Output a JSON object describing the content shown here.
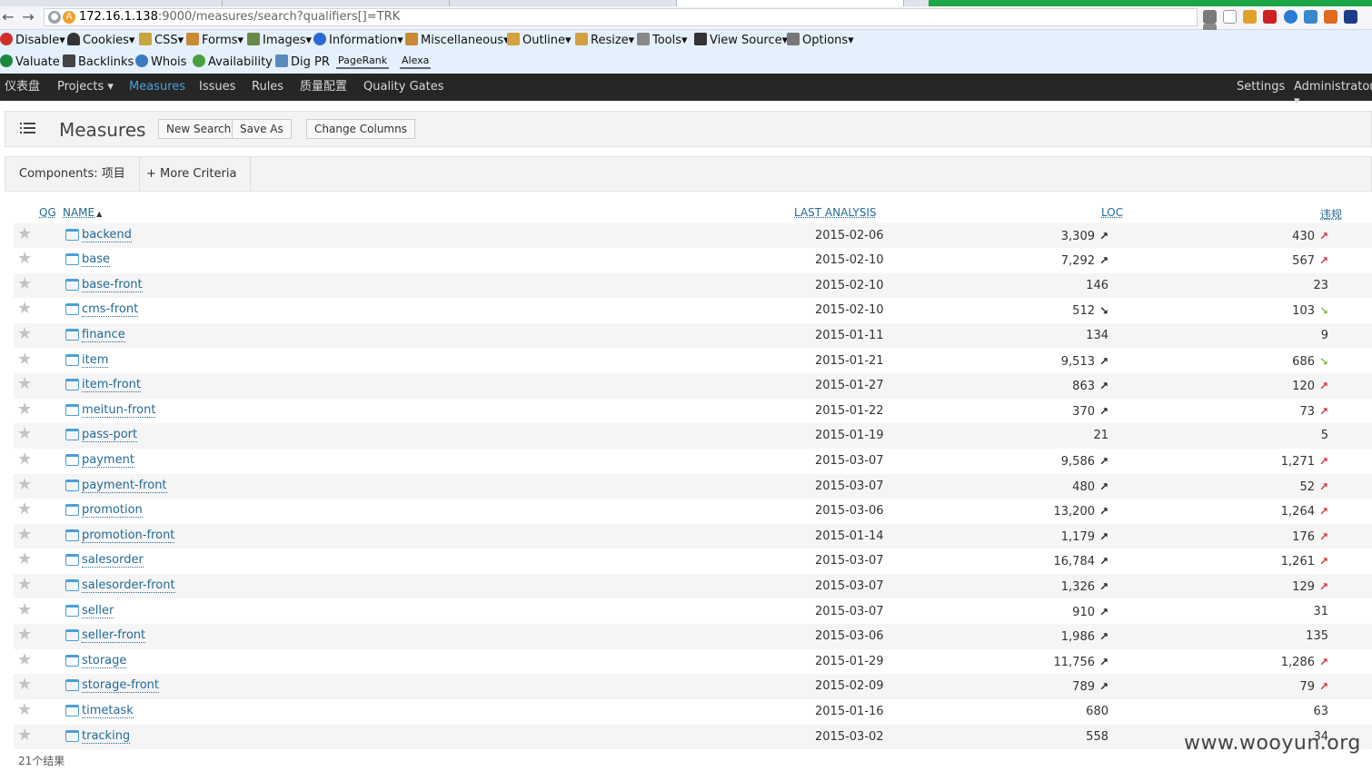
{
  "browser": {
    "url_host": "172.16.1.138",
    "url_rest": ":9000/measures/search?qualifiers[]=TRK"
  },
  "toolbar1": [
    "Disable",
    "Cookies",
    "CSS",
    "Forms",
    "Images",
    "Information",
    "Miscellaneous",
    "Outline",
    "Resize",
    "Tools",
    "View Source",
    "Options"
  ],
  "toolbar2": [
    "Valuate",
    "Backlinks",
    "Whois",
    "Availability",
    "Dig PR"
  ],
  "toolbar2_buttons": [
    "PageRank",
    "Alexa"
  ],
  "nav": {
    "dashboard": "仪表盘",
    "projects": "Projects",
    "measures": "Measures",
    "issues": "Issues",
    "rules": "Rules",
    "quality_profiles": "质量配置",
    "quality_gates": "Quality Gates",
    "settings": "Settings",
    "user": "Administrator"
  },
  "header": {
    "title": "Measures",
    "new_search": "New Search",
    "save_as": "Save As",
    "change_columns": "Change Columns"
  },
  "criteria": {
    "components": "Components: 项目",
    "more": "+ More Criteria"
  },
  "columns": {
    "qg": "QG",
    "name": "NAME",
    "last_analysis": "LAST ANALYSIS",
    "loc": "LOC",
    "violations": "违规"
  },
  "rows": [
    {
      "name": "backend",
      "date": "2015-02-06",
      "loc": "3,309",
      "loc_trend": "up-dark",
      "viol": "430",
      "viol_trend": "up-red"
    },
    {
      "name": "base",
      "date": "2015-02-10",
      "loc": "7,292",
      "loc_trend": "up-dark",
      "viol": "567",
      "viol_trend": "up-red"
    },
    {
      "name": "base-front",
      "date": "2015-02-10",
      "loc": "146",
      "loc_trend": "none",
      "viol": "23",
      "viol_trend": "none"
    },
    {
      "name": "cms-front",
      "date": "2015-02-10",
      "loc": "512",
      "loc_trend": "down-dark",
      "viol": "103",
      "viol_trend": "down-green"
    },
    {
      "name": "finance",
      "date": "2015-01-11",
      "loc": "134",
      "loc_trend": "none",
      "viol": "9",
      "viol_trend": "none"
    },
    {
      "name": "item",
      "date": "2015-01-21",
      "loc": "9,513",
      "loc_trend": "up-dark",
      "viol": "686",
      "viol_trend": "down-green"
    },
    {
      "name": "item-front",
      "date": "2015-01-27",
      "loc": "863",
      "loc_trend": "up-dark",
      "viol": "120",
      "viol_trend": "up-red"
    },
    {
      "name": "meitun-front",
      "date": "2015-01-22",
      "loc": "370",
      "loc_trend": "up-dark",
      "viol": "73",
      "viol_trend": "up-red"
    },
    {
      "name": "pass-port",
      "date": "2015-01-19",
      "loc": "21",
      "loc_trend": "none",
      "viol": "5",
      "viol_trend": "none"
    },
    {
      "name": "payment",
      "date": "2015-03-07",
      "loc": "9,586",
      "loc_trend": "up-dark",
      "viol": "1,271",
      "viol_trend": "up-red"
    },
    {
      "name": "payment-front",
      "date": "2015-03-07",
      "loc": "480",
      "loc_trend": "up-dark",
      "viol": "52",
      "viol_trend": "up-red"
    },
    {
      "name": "promotion",
      "date": "2015-03-06",
      "loc": "13,200",
      "loc_trend": "up-dark",
      "viol": "1,264",
      "viol_trend": "up-red"
    },
    {
      "name": "promotion-front",
      "date": "2015-01-14",
      "loc": "1,179",
      "loc_trend": "up-dark",
      "viol": "176",
      "viol_trend": "up-red"
    },
    {
      "name": "salesorder",
      "date": "2015-03-07",
      "loc": "16,784",
      "loc_trend": "up-dark",
      "viol": "1,261",
      "viol_trend": "up-red"
    },
    {
      "name": "salesorder-front",
      "date": "2015-03-07",
      "loc": "1,326",
      "loc_trend": "up-dark",
      "viol": "129",
      "viol_trend": "up-red"
    },
    {
      "name": "seller",
      "date": "2015-03-07",
      "loc": "910",
      "loc_trend": "up-dark",
      "viol": "31",
      "viol_trend": "none"
    },
    {
      "name": "seller-front",
      "date": "2015-03-06",
      "loc": "1,986",
      "loc_trend": "up-dark",
      "viol": "135",
      "viol_trend": "none"
    },
    {
      "name": "storage",
      "date": "2015-01-29",
      "loc": "11,756",
      "loc_trend": "up-dark",
      "viol": "1,286",
      "viol_trend": "up-red"
    },
    {
      "name": "storage-front",
      "date": "2015-02-09",
      "loc": "789",
      "loc_trend": "up-dark",
      "viol": "79",
      "viol_trend": "up-red"
    },
    {
      "name": "timetask",
      "date": "2015-01-16",
      "loc": "680",
      "loc_trend": "none",
      "viol": "63",
      "viol_trend": "none"
    },
    {
      "name": "tracking",
      "date": "2015-03-02",
      "loc": "558",
      "loc_trend": "none",
      "viol": "34",
      "viol_trend": "none"
    }
  ],
  "footer": {
    "result_count": "21个结果"
  },
  "watermark": "www.wooyun.org"
}
